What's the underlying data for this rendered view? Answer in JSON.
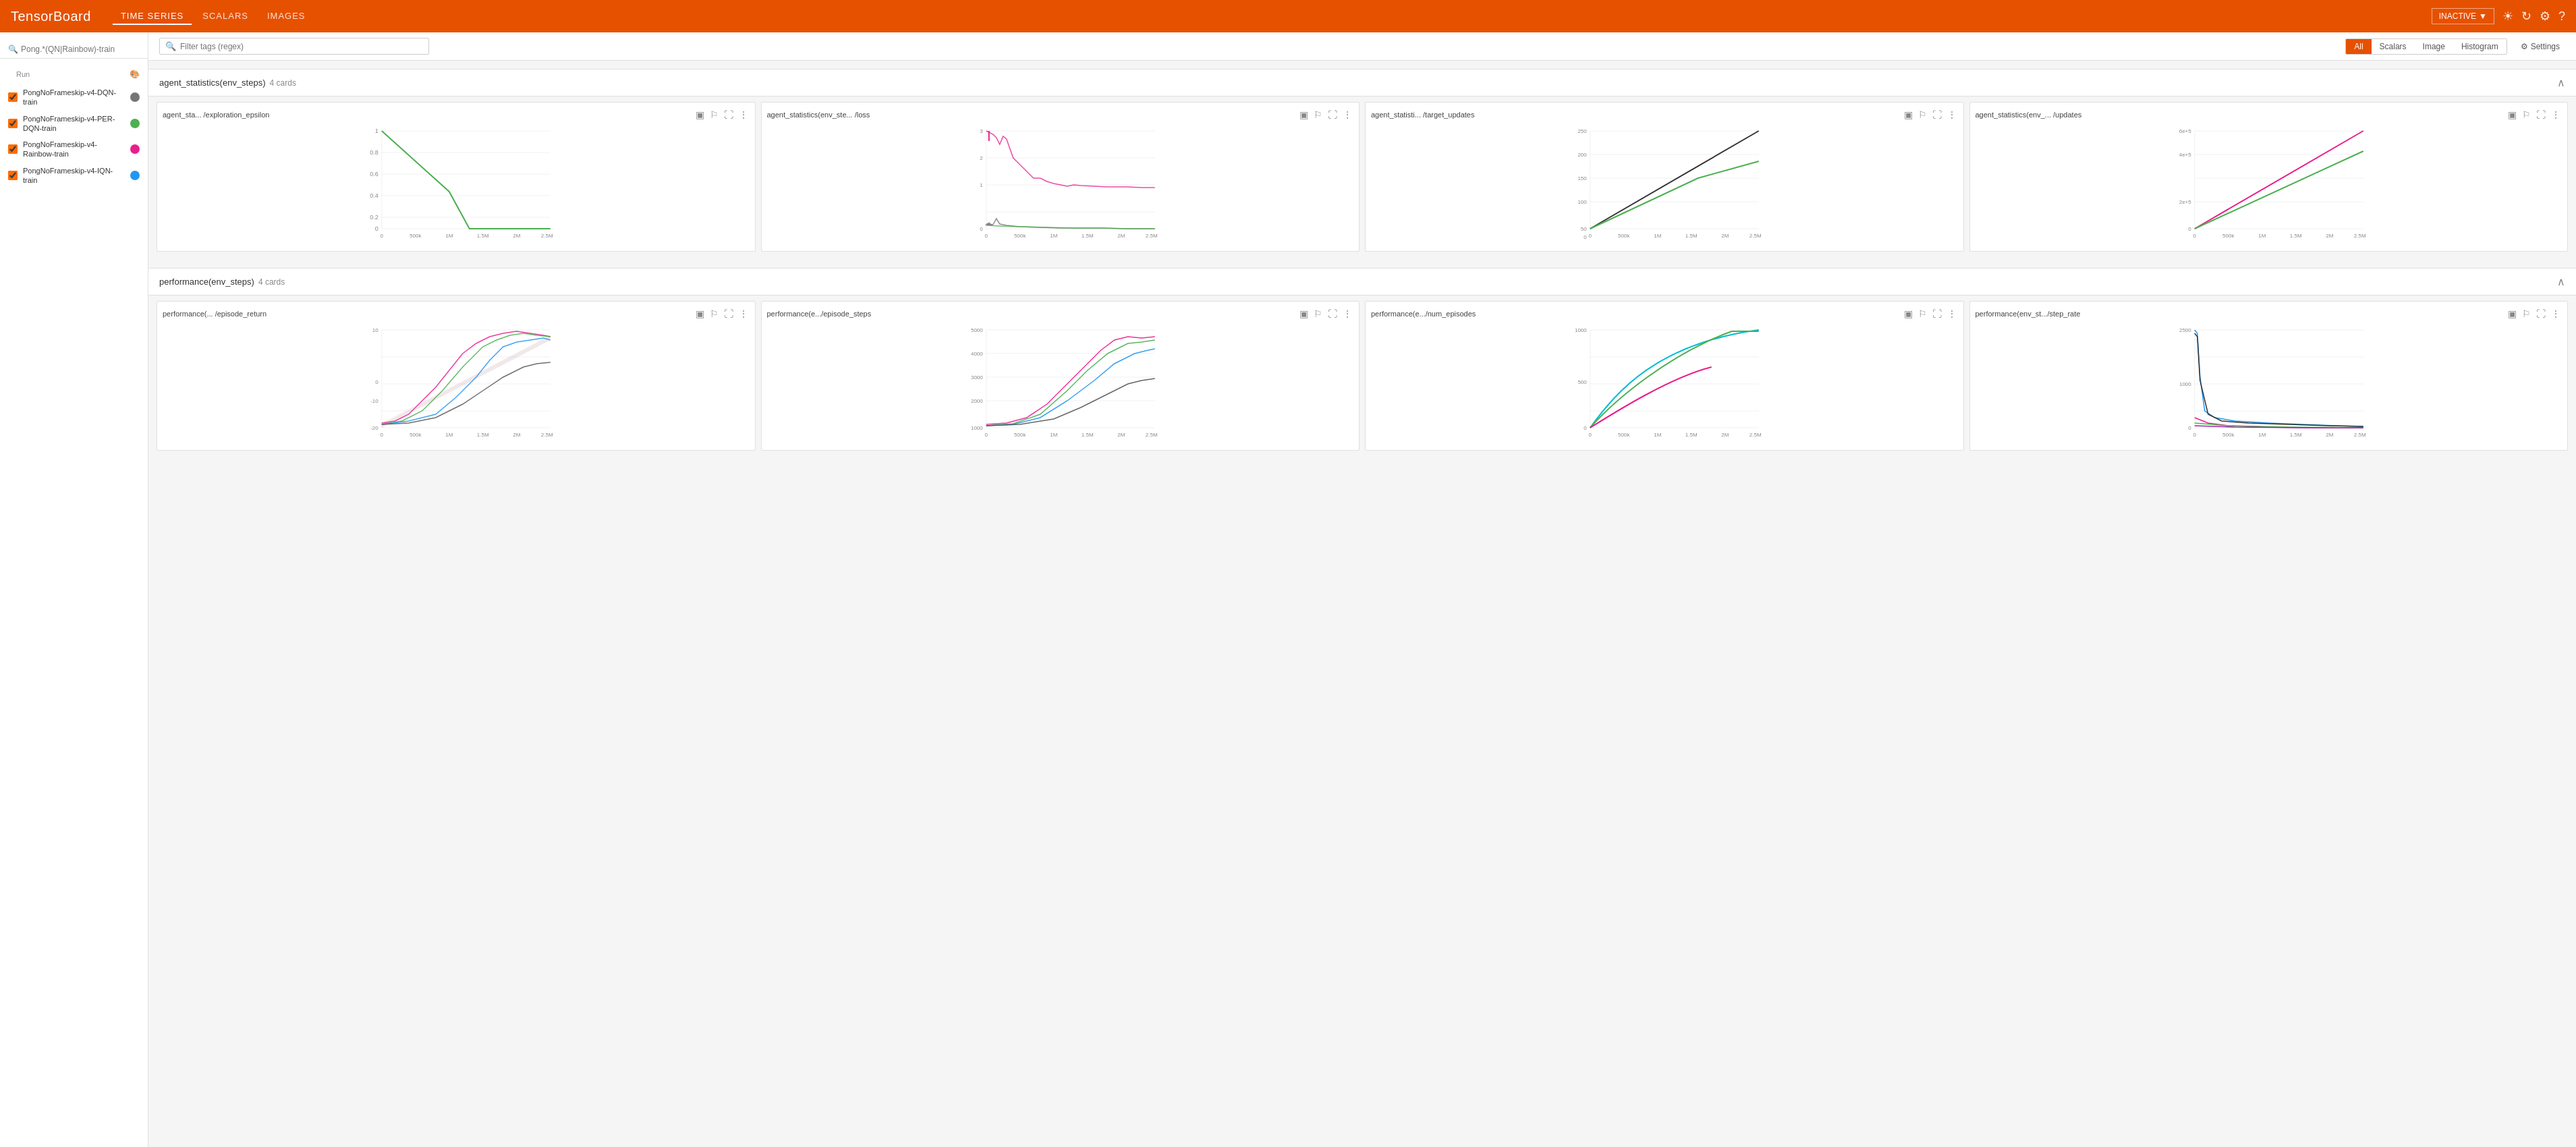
{
  "topnav": {
    "logo": "TensorBoard",
    "links": [
      {
        "label": "TIME SERIES",
        "active": true
      },
      {
        "label": "SCALARS",
        "active": false
      },
      {
        "label": "IMAGES",
        "active": false
      }
    ],
    "inactive_label": "INACTIVE",
    "icons": [
      "sun",
      "refresh",
      "settings",
      "help"
    ]
  },
  "sidebar": {
    "search_placeholder": "Pong.*(QN|Rainbow)-train",
    "section_label": "Run",
    "palette_icon": "🎨",
    "runs": [
      {
        "label": "PongNoFrameskip-v4-DQN-train",
        "color": "#757575",
        "checked": true
      },
      {
        "label": "PongNoFrameskip-v4-PER-DQN-train",
        "color": "#4CAF50",
        "checked": true
      },
      {
        "label": "PongNoFrameskip-v4-Rainbow-train",
        "color": "#E91E8C",
        "checked": true
      },
      {
        "label": "PongNoFrameskip-v4-IQN-train",
        "color": "#2196F3",
        "checked": true
      }
    ]
  },
  "toolbar": {
    "filter_placeholder": "Filter tags (regex)",
    "filter_buttons": [
      "All",
      "Scalars",
      "Image",
      "Histogram"
    ],
    "active_filter": "All",
    "settings_label": "Settings"
  },
  "sections": [
    {
      "id": "agent_statistics",
      "title": "agent_statistics(env_steps)",
      "card_count": "4 cards",
      "collapsed": false,
      "cards": [
        {
          "title": "agent_sta... /exploration_epsilon",
          "type": "line_decreasing"
        },
        {
          "title": "agent_statistics(env_ste... /loss",
          "type": "line_loss"
        },
        {
          "title": "agent_statisti... /target_updates",
          "type": "line_linear_multi"
        },
        {
          "title": "agent_statistics(env_... /updates",
          "type": "line_linear_multi2"
        }
      ]
    },
    {
      "id": "performance",
      "title": "performance(env_steps)",
      "card_count": "4 cards",
      "collapsed": false,
      "cards": [
        {
          "title": "performance(... /episode_return",
          "type": "line_episode_return"
        },
        {
          "title": "performance(e.../episode_steps",
          "type": "line_episode_steps"
        },
        {
          "title": "performance(e.../num_episodes",
          "type": "line_num_episodes"
        },
        {
          "title": "performance(env_st.../step_rate",
          "type": "line_step_rate"
        }
      ]
    }
  ]
}
